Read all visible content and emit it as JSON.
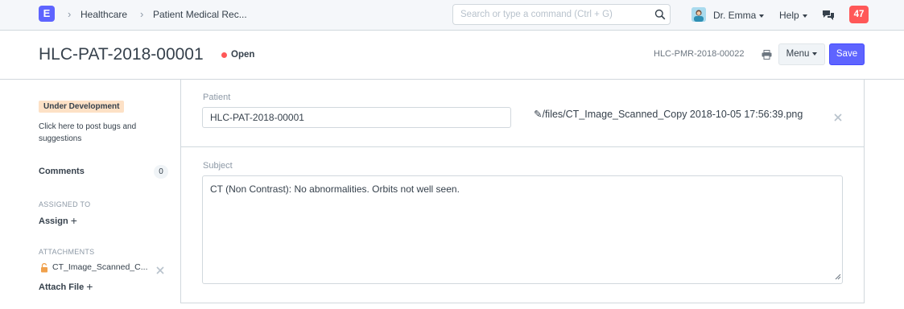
{
  "navbar": {
    "logo_letter": "E",
    "breadcrumbs": [
      "Healthcare",
      "Patient Medical Rec..."
    ],
    "search_placeholder": "Search or type a command (Ctrl + G)",
    "user_name": "Dr. Emma",
    "help_label": "Help",
    "notification_count": "47",
    "icons": [
      "search-icon",
      "chat-icon"
    ]
  },
  "header": {
    "title": "HLC-PAT-2018-00001",
    "status": "Open",
    "status_color": "#ff5858",
    "doc_name": "HLC-PMR-2018-00022",
    "menu_label": "Menu",
    "save_label": "Save",
    "accent_color": "#5e64ff"
  },
  "sidebar": {
    "dev_badge": "Under Development",
    "dev_text": "Click here to post bugs and suggestions",
    "comments_label": "Comments",
    "comments_count": "0",
    "assigned_label": "ASSIGNED TO",
    "assign_label": "Assign",
    "attachments_label": "ATTACHMENTS",
    "attachment_name": "CT_Image_Scanned_C...",
    "attach_file_label": "Attach File"
  },
  "form": {
    "patient_label": "Patient",
    "patient_value": "HLC-PAT-2018-00001",
    "file_link": "/files/CT_Image_Scanned_Copy 2018-10-05 17:56:39.png",
    "subject_label": "Subject",
    "subject_value": "CT (Non Contrast): No abnormalities. Orbits not well seen."
  }
}
